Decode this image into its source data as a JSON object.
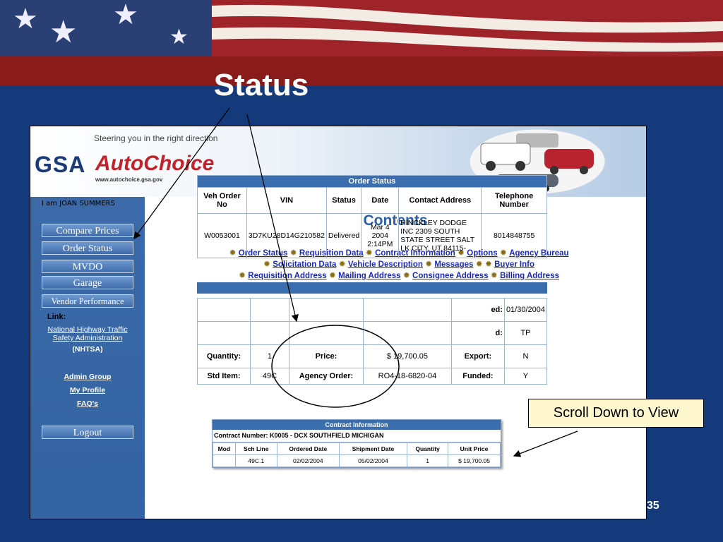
{
  "slide": {
    "title": "Status",
    "callout": "Scroll Down to View",
    "page_number": "35"
  },
  "banner": {
    "tagline": "Steering you in the right direction",
    "logo_text": "GSA",
    "brand": "AutoChoice",
    "url": "www.autochoice.gsa.gov"
  },
  "nav": {
    "user": "I am JOAN SUMMERS",
    "buttons": [
      "Compare Prices",
      "Order Status",
      "MVDO",
      "Garage",
      "Vendor Performance"
    ],
    "link_header": "Link:",
    "nhtsa_link": "National Highway Traffic Safety Administration",
    "nhtsa_abbr": "(NHTSA)",
    "links": [
      "Admin Group",
      "My Profile",
      "FAQ's"
    ],
    "logout": "Logout"
  },
  "contents": {
    "title": "Contents",
    "links": [
      "Order Status",
      "Requisition Data",
      "Contract Information",
      "Options",
      "Agency Bureau",
      "Solicitation Data",
      "Vehicle Description",
      "Messages",
      "Buyer Info",
      "Requisition Address",
      "Mailing Address",
      "Consignee Address",
      "Billing Address"
    ]
  },
  "order_status": {
    "title": "Order Status",
    "headers": [
      "Veh Order No",
      "VIN",
      "Status",
      "Date",
      "Contact Address",
      "Telephone Number"
    ],
    "row": [
      "W0053001",
      "3D7KU28D14G210582",
      "Delivered",
      "Mar 4 2004 2:14PM",
      "HINCKLEY DODGE INC 2309 SOUTH STATE STREET SALT LK CITY, UT 84115-",
      "8014848755"
    ]
  },
  "details": {
    "row1_label_partial": "ed:",
    "row1_value": "01/30/2004",
    "row2_label_partial": "d:",
    "row2_value": "TP",
    "row3": {
      "quantity_label": "Quantity:",
      "quantity_value": "1",
      "unit_price_label": "Price:",
      "unit_price_value": "$ 19,700.05",
      "export_label": "Export:",
      "export_value": "N"
    },
    "row4": {
      "std_item_label": "Std Item:",
      "std_item_value": "49C",
      "agency_order_label": "Agency Order:",
      "agency_order_value": "RO4-18-6820-04",
      "funded_label": "Funded:",
      "funded_value": "Y"
    }
  },
  "contract_info": {
    "title": "Contract Information",
    "contract_number": "Contract Number: K0005 - DCX SOUTHFIELD MICHIGAN",
    "headers": [
      "Mod",
      "Sch Line",
      "Ordered Date",
      "Shipment Date",
      "Quantity",
      "Unit Price"
    ],
    "row": [
      "",
      "49C.1",
      "02/02/2004",
      "05/02/2004",
      "1",
      "$ 19,700.05"
    ]
  }
}
